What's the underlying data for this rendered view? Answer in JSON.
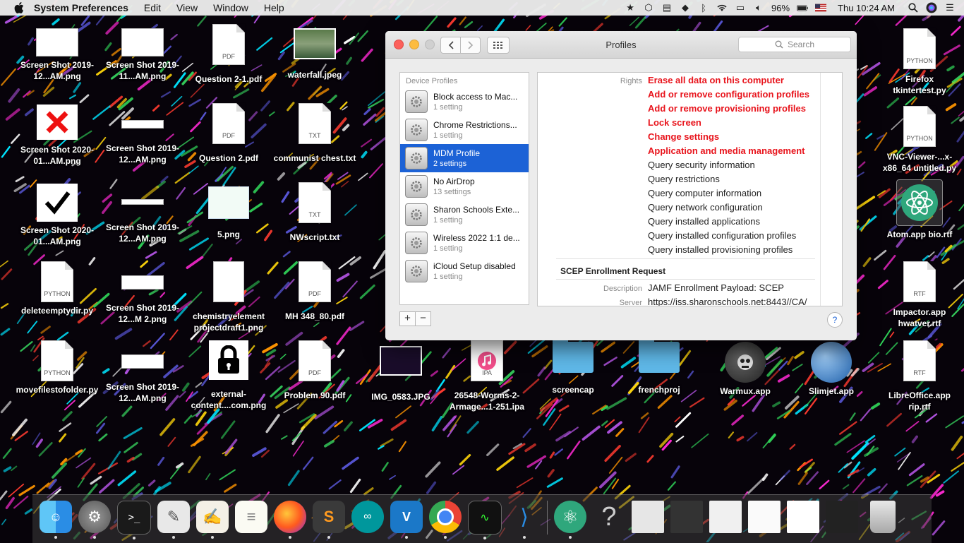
{
  "menubar": {
    "app_name": "System Preferences",
    "menus": [
      "Edit",
      "View",
      "Window",
      "Help"
    ],
    "battery": "96%",
    "clock": "Thu 10:24 AM",
    "status_icons": [
      "star-icon",
      "cube-icon",
      "drive-icon",
      "dropbox-icon",
      "bluetooth-icon",
      "wifi-icon",
      "airplay-icon",
      "volume-icon",
      "battery-icon",
      "flag-icon",
      "search-icon",
      "siri-icon",
      "list-icon"
    ]
  },
  "desktop": {
    "col1": [
      "Screen Shot 2019-12...AM.png",
      "Screen Shot 2020-01...AM.png",
      "Screen Shot 2020-01...AM.png",
      "deleteemptydir.py",
      "movefilestofolder.py"
    ],
    "col2": [
      "Screen Shot 2019-11...AM.png",
      "Screen Shot 2019-12...AM.png",
      "Screen Shot 2019-12...AM.png",
      "Screen Shot 2019-12...M 2.png",
      "Screen Shot 2019-12...AM.png"
    ],
    "col3": [
      "Question 2-1.pdf",
      "Question 2.pdf",
      "5.png",
      "chemistryelement projectdraft1.png",
      "external-content....com.png"
    ],
    "col4": [
      "waterfall.jpeg",
      "communist chest.txt",
      "NWscript.txt",
      "MH 348_80.pdf",
      "Problem 90.pdf"
    ],
    "bottom_row": [
      "IMG_0583.JPG",
      "26548-Worms-2-Armage...1-251.ipa",
      "screencap",
      "frenchproj",
      "Warmux.app",
      "Slimjet.app",
      "LibreOffice.app rip.rtf"
    ],
    "right_col": [
      "Firefox tkintertest.py",
      "VNC-Viewer-...x-x86_64 untitled.py",
      "Atom.app bio.rtf",
      "Impactor.app hwatver.rtf"
    ],
    "tags": {
      "pdf": "PDF",
      "txt": "TXT",
      "python": "PYTHON",
      "rtf": "RTF",
      "ipa": "IPA"
    }
  },
  "window": {
    "title": "Profiles",
    "search_placeholder": "Search",
    "list_header": "Device Profiles",
    "profiles": [
      {
        "name": "Block access to Mac...",
        "sub": "1 setting"
      },
      {
        "name": "Chrome Restrictions...",
        "sub": "1 setting"
      },
      {
        "name": "MDM Profile",
        "sub": "2 settings",
        "selected": true
      },
      {
        "name": "No AirDrop",
        "sub": "13 settings"
      },
      {
        "name": "Sharon Schools Exte...",
        "sub": "1 setting"
      },
      {
        "name": "Wireless 2022 1:1 de...",
        "sub": "1 setting"
      },
      {
        "name": "iCloud Setup disabled",
        "sub": "1 setting"
      }
    ],
    "add_label": "+",
    "remove_label": "−",
    "help_label": "?",
    "rights_label": "Rights",
    "rights": [
      {
        "text": "Erase all data on this computer",
        "warning": true
      },
      {
        "text": "Add or remove configuration profiles",
        "warning": true
      },
      {
        "text": "Add or remove provisioning profiles",
        "warning": true
      },
      {
        "text": "Lock screen",
        "warning": true
      },
      {
        "text": "Change settings",
        "warning": true
      },
      {
        "text": "Application and media management",
        "warning": true
      },
      {
        "text": "Query security information",
        "warning": false
      },
      {
        "text": "Query restrictions",
        "warning": false
      },
      {
        "text": "Query computer information",
        "warning": false
      },
      {
        "text": "Query network configuration",
        "warning": false
      },
      {
        "text": "Query installed applications",
        "warning": false
      },
      {
        "text": "Query installed configuration profiles",
        "warning": false
      },
      {
        "text": "Query installed provisioning profiles",
        "warning": false
      }
    ],
    "scep_section": "SCEP Enrollment Request",
    "description_label": "Description",
    "description_value": "JAMF Enrollment Payload: SCEP",
    "server_label": "Server",
    "server_value": "https://iss.sharonschools.net:8443//CA/"
  },
  "dock": {
    "apps": [
      "finder-icon",
      "system-preferences-icon",
      "terminal-icon",
      "script-editor-icon",
      "textedit-icon",
      "notes-icon",
      "firefox-icon",
      "sublime-text-icon",
      "arduino-icon",
      "vnc-viewer-icon",
      "chrome-icon",
      "activity-monitor-icon",
      "vscode-icon"
    ],
    "others": [
      "atom-icon",
      "help-icon",
      "window-thumb-1",
      "window-thumb-2",
      "window-thumb-3",
      "window-thumb-4",
      "window-thumb-5",
      "window-thumb-6",
      "trash-icon"
    ],
    "colors": {
      "accent": "#1c62d6",
      "warning": "#e8141c"
    }
  }
}
